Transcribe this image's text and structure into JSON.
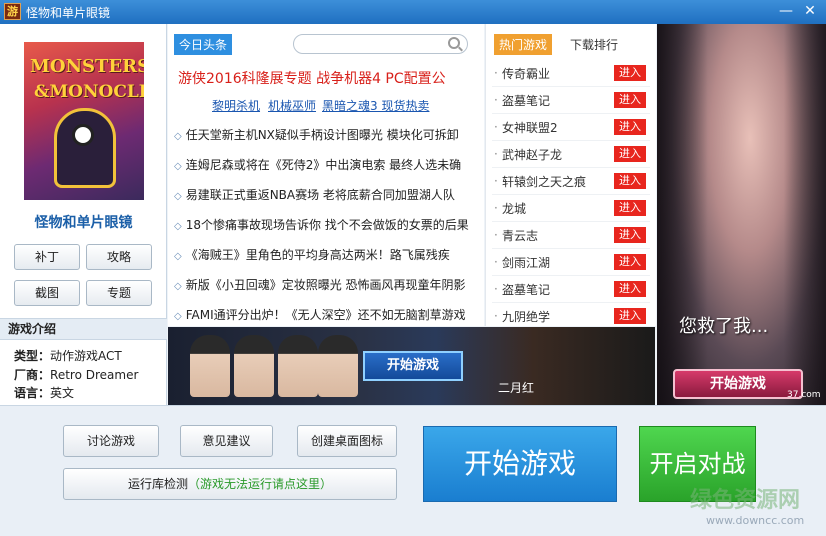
{
  "window": {
    "title": "怪物和单片眼镜",
    "icon_text": "游",
    "minimize": "—",
    "close": "✕"
  },
  "left": {
    "cover_line1": "MONSTERS",
    "cover_line2": "&MONOCLES",
    "game_name": "怪物和单片眼镜",
    "buttons": [
      "补丁",
      "攻略",
      "截图",
      "专题"
    ],
    "intro_title": "游戏介绍",
    "intro": [
      {
        "label": "类型：",
        "value": "动作游戏ACT"
      },
      {
        "label": "厂商：",
        "value": "Retro Dreamer"
      },
      {
        "label": "语言：",
        "value": "英文"
      }
    ]
  },
  "news": {
    "tab": "今日头条",
    "search_placeholder": "",
    "headline": "游侠2016科隆展专题  战争机器4 PC配置公",
    "sublinks": [
      "黎明杀机",
      "机械巫师",
      "黑暗之魂3 现货热卖"
    ],
    "items": [
      "任天堂新主机NX疑似手柄设计图曝光 模块化可拆卸",
      "连姆尼森或将在《死侍2》中出演电索 最终人选未确",
      "易建联正式重返NBA赛场 老将底薪合同加盟湖人队",
      "18个惨痛事故现场告诉你 找个不会做饭的女票的后果",
      "《海贼王》里角色的平均身高达两米！路飞属残疾",
      "新版《小丑回魂》定妆照曝光 恐怖画风再现童年阴影",
      "FAMI通评分出炉！《无人深空》还不如无脑割草游戏"
    ]
  },
  "hot": {
    "tab_hot": "热门游戏",
    "tab_rank": "下载排行",
    "enter_label": "进入",
    "games": [
      "传奇霸业",
      "盗墓笔记",
      "女神联盟2",
      "武神赵子龙",
      "轩辕剑之天之痕",
      "龙城",
      "青云志",
      "剑雨江湖",
      "盗墓笔记",
      "九阴绝学"
    ]
  },
  "banner": {
    "start_label": "开始游戏",
    "caption": "二月红"
  },
  "promo": {
    "line": "您救了我...",
    "button": "开始游戏",
    "brand": "37.com"
  },
  "bottom": {
    "discuss": "讨论游戏",
    "feedback": "意见建议",
    "shortcut": "创建桌面图标",
    "runtime_prefix": "运行库检测",
    "runtime_note": "（游戏无法运行请点这里）",
    "start": "开始游戏",
    "duel": "开启对战",
    "watermark": "绿色资源网",
    "watermark_url": "www.downcc.com"
  }
}
